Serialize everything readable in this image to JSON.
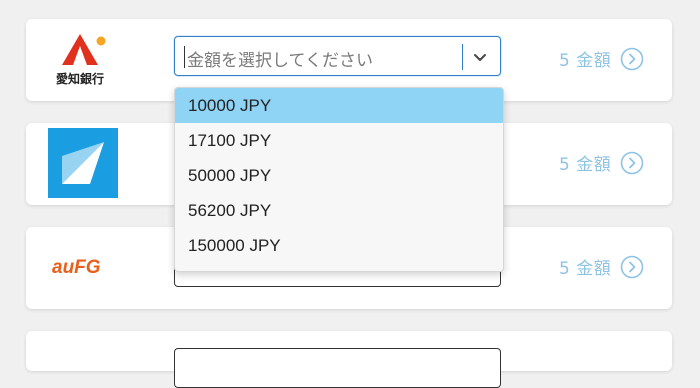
{
  "rows": [
    {
      "bank_name": "愛知銀行",
      "select": {
        "placeholder": "金額を選択してください"
      },
      "amount_text": "5 金額"
    },
    {
      "amount_text": "5 金額"
    },
    {
      "bank_name": "auFG",
      "amount_text": "5 金額"
    }
  ],
  "dropdown": {
    "options": [
      "10000 JPY",
      "17100 JPY",
      "50000 JPY",
      "56200 JPY",
      "150000 JPY"
    ],
    "highlighted_index": 0
  },
  "colors": {
    "accent": "#8ec3e3",
    "highlight": "#8fd3f5",
    "focus_border": "#2f80c9",
    "aichi_red": "#e0301e",
    "aichi_orange": "#f5a623",
    "blue_logo": "#1b9de2",
    "aufg_orange": "#e8601c"
  },
  "icons": [
    "chevron-down-icon",
    "chevron-right-circle-icon"
  ]
}
